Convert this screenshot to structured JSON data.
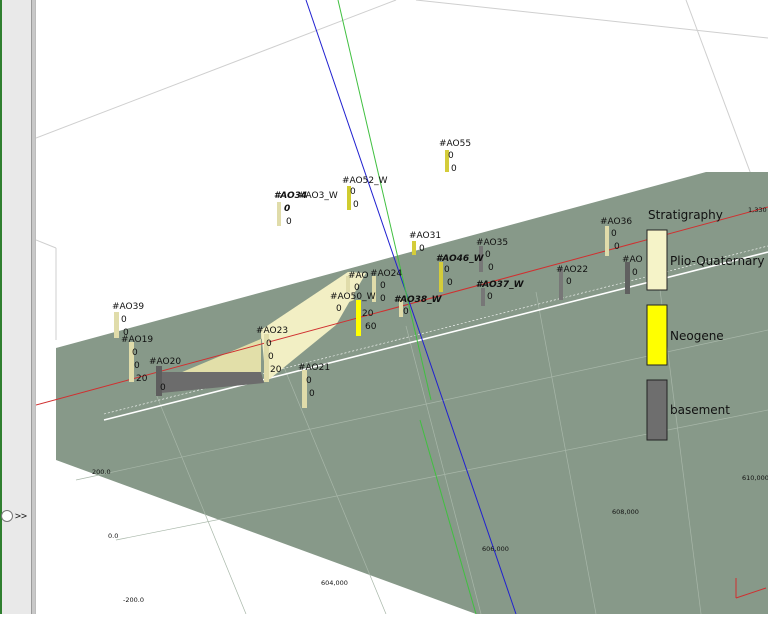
{
  "legend": {
    "title": "Stratigraphy",
    "items": [
      {
        "label": "Plio-Quaternary",
        "color": "#f5f3c8"
      },
      {
        "label": "Neogene",
        "color": "#ffff00"
      },
      {
        "label": "basement",
        "color": "#6e6e6e"
      }
    ]
  },
  "panel": {
    "expand_label": ">>"
  },
  "axis_labels": {
    "y_top": "200.0",
    "y_mid": "0.0",
    "y_bottom": "-200.0",
    "x_left": "604,000",
    "x_mid": "606,000",
    "x_right": "608,000",
    "x_far": "610,000",
    "corner_top_right": "1,330"
  },
  "wells": [
    {
      "id": "w1",
      "name": "#AO55",
      "vals": [
        "0",
        "0"
      ]
    },
    {
      "id": "w2",
      "name": "#AO52_W",
      "vals": [
        "0",
        "0"
      ]
    },
    {
      "id": "w3",
      "name": "#AO34",
      "overlap": "#AO3_W",
      "vals": [
        "0",
        "0"
      ]
    },
    {
      "id": "w4",
      "name": "#AO31",
      "vals": [
        "0"
      ]
    },
    {
      "id": "w5",
      "name": "#AO35",
      "vals": [
        "0",
        "0"
      ]
    },
    {
      "id": "w6",
      "name": "#AO46_W",
      "vals": [
        "0",
        "0"
      ]
    },
    {
      "id": "w7",
      "name": "#AO36",
      "vals": [
        "0",
        "0"
      ]
    },
    {
      "id": "w8",
      "name": "#AO",
      "vals": [
        "0"
      ]
    },
    {
      "id": "w9",
      "name": "#AO22",
      "vals": [
        "0"
      ]
    },
    {
      "id": "w10",
      "name": "#AO24",
      "vals": [
        "0",
        "0"
      ]
    },
    {
      "id": "w11",
      "name": "#AO",
      "vals": [
        "0"
      ]
    },
    {
      "id": "w12",
      "name": "#AO37_W",
      "vals": [
        "0"
      ]
    },
    {
      "id": "w13",
      "name": "#AO50_W",
      "vals": [
        "0",
        "20",
        "60"
      ]
    },
    {
      "id": "w14",
      "name": "#AO38_W",
      "vals": [
        "0"
      ]
    },
    {
      "id": "w15",
      "name": "#AO39",
      "vals": [
        "0",
        "0"
      ]
    },
    {
      "id": "w16",
      "name": "#AO19",
      "vals": [
        "0",
        "0",
        "20"
      ]
    },
    {
      "id": "w17",
      "name": "#AO20",
      "vals": [
        "0"
      ]
    },
    {
      "id": "w18",
      "name": "#AO23",
      "vals": [
        "0",
        "0",
        "20"
      ]
    },
    {
      "id": "w19",
      "name": "#AO21",
      "vals": [
        "0",
        "0"
      ]
    }
  ]
}
